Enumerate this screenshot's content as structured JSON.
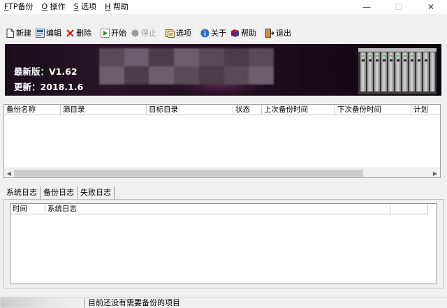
{
  "menu": {
    "items": [
      {
        "accel": "F",
        "label": "TP备份"
      },
      {
        "accel": "O",
        "label": " 操作"
      },
      {
        "accel": "S",
        "label": " 选项"
      },
      {
        "accel": "H",
        "label": " 帮助"
      }
    ]
  },
  "window_controls": {
    "minimize": "—",
    "maximize": "☐",
    "close": "✕"
  },
  "toolbar": {
    "new_label": "新建",
    "edit_label": "编辑",
    "delete_label": "删除",
    "start_label": "开始",
    "stop_label": "停止",
    "options_label": "选项",
    "about_label": "关于",
    "help_label": "帮助",
    "exit_label": "退出"
  },
  "banner": {
    "version": "最新版：V1.62",
    "update": "更新：2018.1.6"
  },
  "job_list": {
    "columns": [
      "备份名称",
      "源目录",
      "目标目录",
      "状态",
      "上次备份时间",
      "下次备份时间",
      "计划"
    ],
    "rows": []
  },
  "tabs": [
    "系统日志",
    "备份日志",
    "失败日志"
  ],
  "log_list": {
    "columns": [
      "时间",
      "系统日志",
      ""
    ],
    "rows": []
  },
  "status": {
    "message": "目前还没有需要备份的项目"
  }
}
